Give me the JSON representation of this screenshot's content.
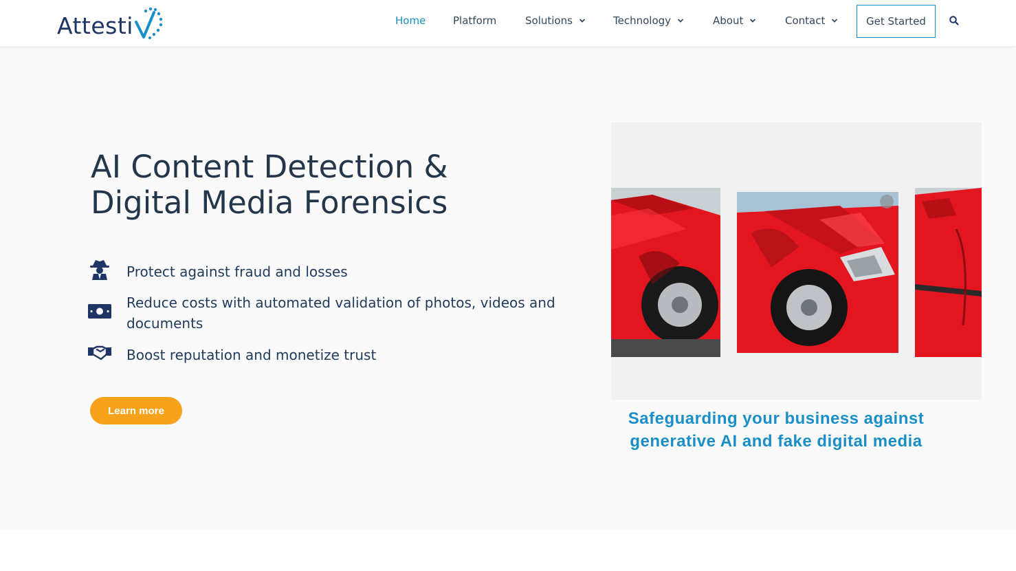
{
  "brand": {
    "name": "Attestiv",
    "logo_text": "Attesti"
  },
  "colors": {
    "accent": "#1a8fc7",
    "brand_dark": "#1e3566",
    "cta_orange": "#f7a21b",
    "car_red": "#e3161f"
  },
  "nav": {
    "items": [
      {
        "label": "Home",
        "active": true,
        "has_dropdown": false
      },
      {
        "label": "Platform",
        "active": false,
        "has_dropdown": false
      },
      {
        "label": "Solutions",
        "active": false,
        "has_dropdown": true
      },
      {
        "label": "Technology",
        "active": false,
        "has_dropdown": true
      },
      {
        "label": "About",
        "active": false,
        "has_dropdown": true
      },
      {
        "label": "Contact",
        "active": false,
        "has_dropdown": true
      }
    ],
    "cta_label": "Get Started",
    "search_icon": "search-icon"
  },
  "hero": {
    "headline_line1": "AI Content Detection &",
    "headline_line2": "Digital Media Forensics",
    "features": [
      {
        "icon": "spy-icon",
        "text": "Protect against fraud and losses"
      },
      {
        "icon": "banknote-icon",
        "text": "Reduce costs with automated validation of photos, videos and documents"
      },
      {
        "icon": "handshake-icon",
        "text": "Boost reputation and monetize trust"
      }
    ],
    "learn_more_label": "Learn more"
  },
  "media": {
    "description_icons": [
      "damaged-red-car-photo",
      "damaged-red-car-photo",
      "damaged-red-car-photo"
    ],
    "caption": "Safeguarding your business against generative AI and fake digital media"
  }
}
